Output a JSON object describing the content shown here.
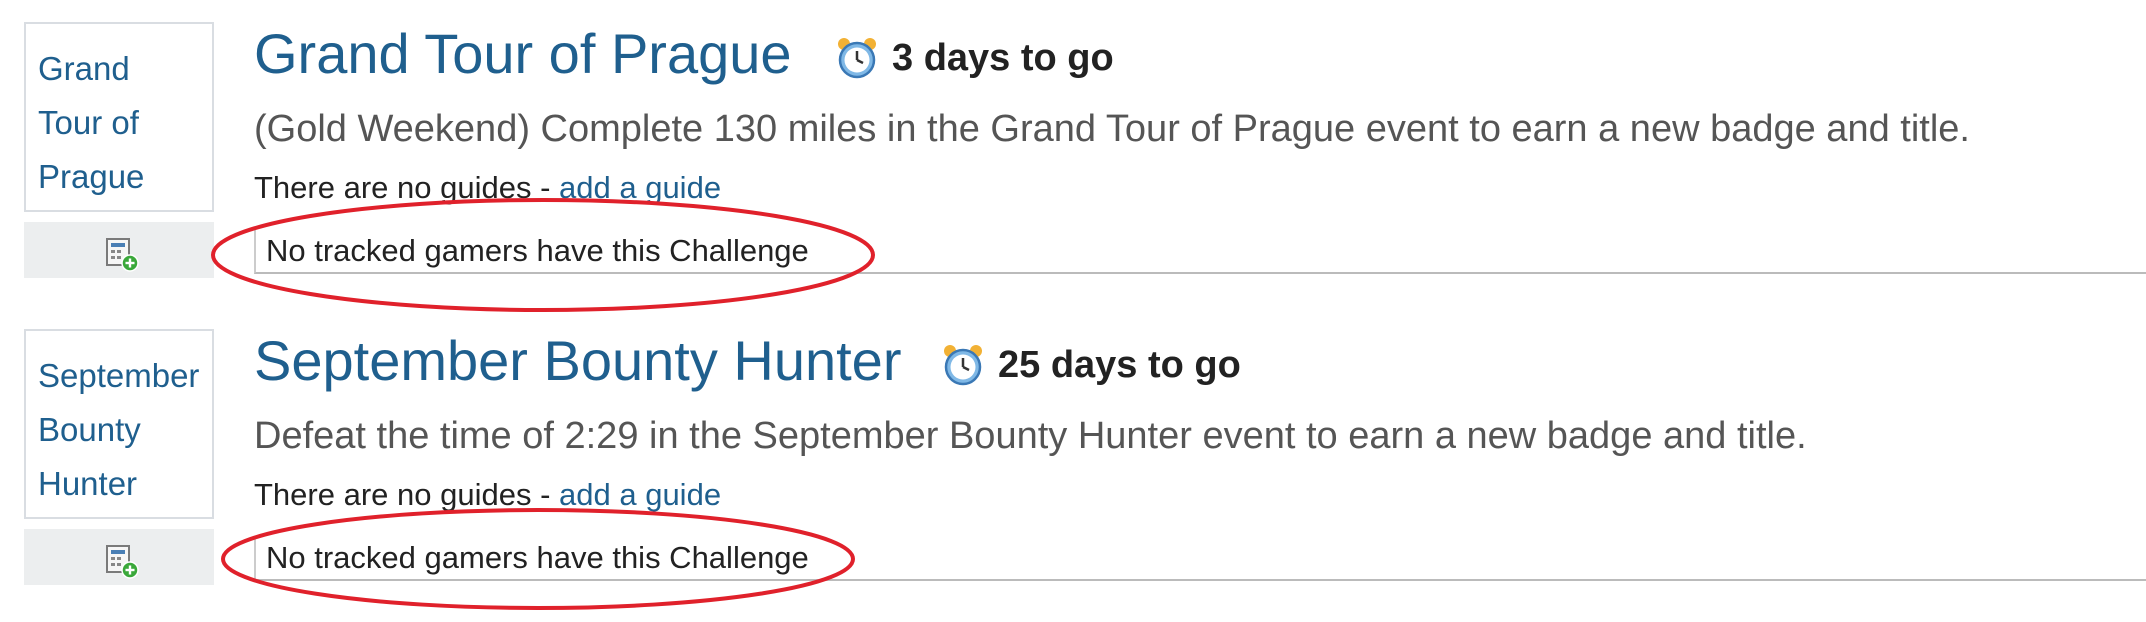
{
  "challenges": [
    {
      "thumb_lines": [
        "Grand",
        "Tour of",
        "Prague"
      ],
      "title": "Grand Tour of Prague",
      "countdown": "3 days to go",
      "description": "(Gold Weekend) Complete 130 miles in the Grand Tour of Prague event to earn a new badge and title.",
      "guides_text": "There are no guides - ",
      "guides_link": "add a guide",
      "tracked_text": "No tracked gamers have this Challenge"
    },
    {
      "thumb_lines": [
        "September",
        "Bounty",
        "Hunter"
      ],
      "title": "September Bounty Hunter",
      "countdown": "25 days to go",
      "description": "Defeat the time of 2:29 in the September Bounty Hunter event to earn a new badge and title.",
      "guides_text": "There are no guides - ",
      "guides_link": "add a guide",
      "tracked_text": "No tracked gamers have this Challenge"
    }
  ],
  "colors": {
    "title": "#1f5f8e",
    "annotation": "#e0212b"
  },
  "icons": {
    "countdown": "alarm-clock-icon",
    "tracker": "add-tracker-icon"
  }
}
